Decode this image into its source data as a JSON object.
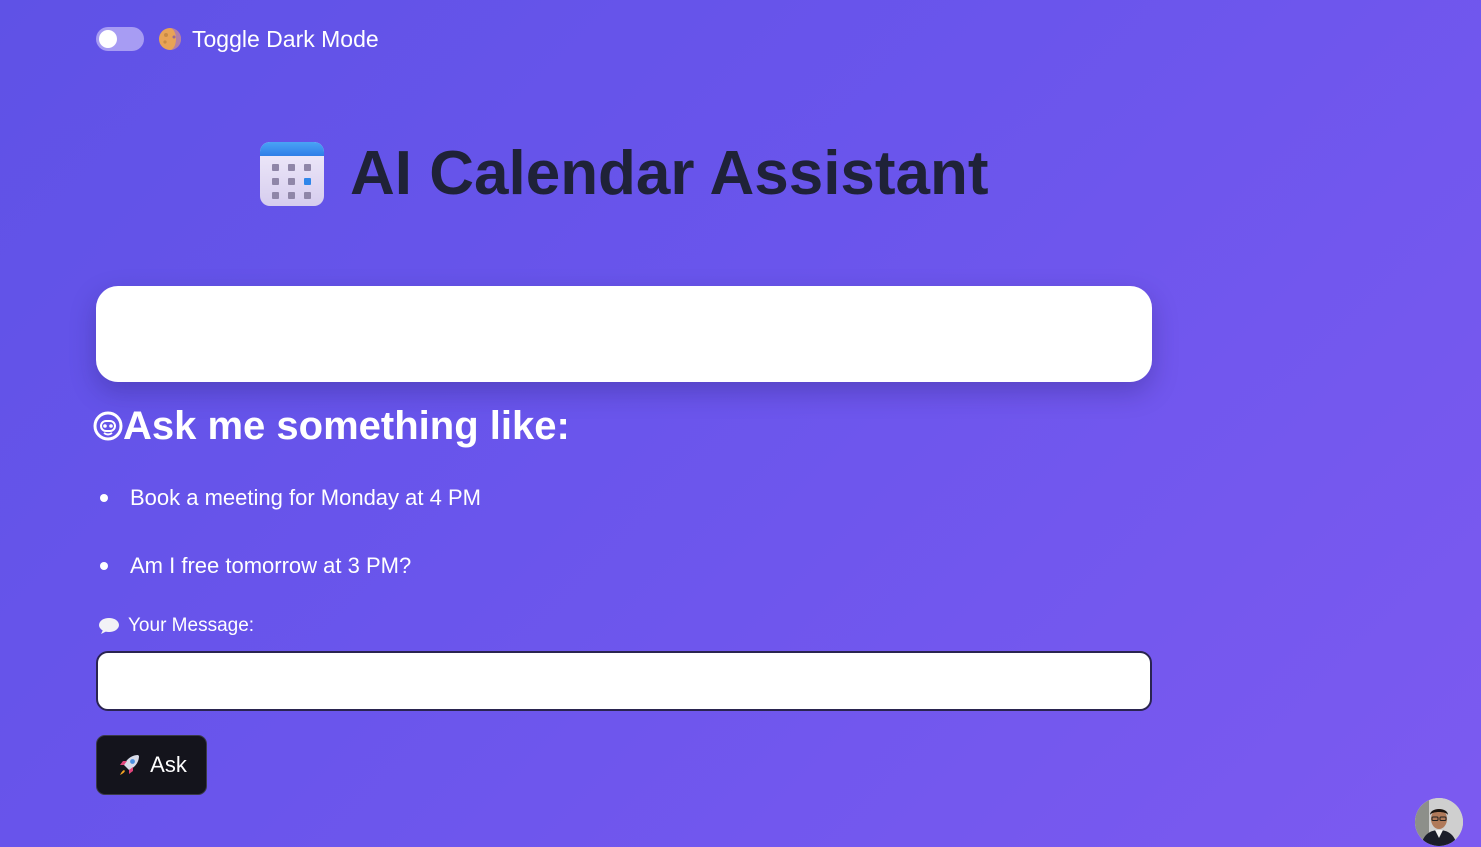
{
  "header": {
    "toggle": {
      "label": "Toggle Dark Mode",
      "state": "off",
      "icon": "moon-icon"
    }
  },
  "hero": {
    "icon": "calendar-icon",
    "title": "AI Calendar Assistant"
  },
  "response_card": {
    "text": ""
  },
  "examples": {
    "icon": "robot-icon",
    "heading": "Ask me something like:",
    "items": [
      "Book a meeting for Monday at 4 PM",
      "Am I free tomorrow at 3 PM?"
    ]
  },
  "message": {
    "icon": "speech-balloon-icon",
    "label": "Your Message:",
    "value": "",
    "placeholder": ""
  },
  "ask_button": {
    "icon": "rocket-icon",
    "label": "Ask"
  },
  "avatar": {
    "icon": "user-avatar"
  },
  "colors": {
    "background_start": "#5f52e6",
    "background_end": "#7c5af0",
    "title": "#1f2238",
    "button": "#14141c",
    "card": "#ffffff"
  }
}
